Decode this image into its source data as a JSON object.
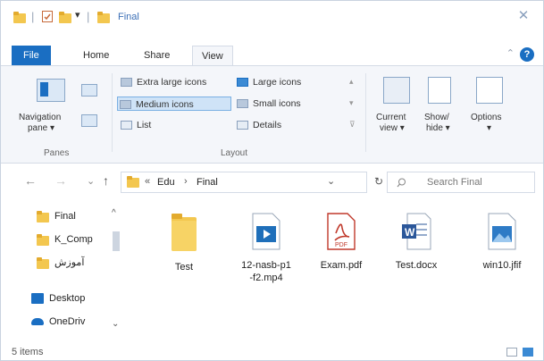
{
  "title": "Final",
  "quick_access": {
    "pin_symbol": "▾"
  },
  "window_controls": {
    "close": "✕"
  },
  "ribbon_tabs": {
    "file": "File",
    "home": "Home",
    "share": "Share",
    "view": "View"
  },
  "help_label": "?",
  "collapse_symbol": "⌃",
  "ribbon": {
    "navigation_pane_line1": "Navigation",
    "navigation_pane_line2": "pane ▾",
    "panes_label": "Panes",
    "layout": {
      "extra_large_icons": "Extra large icons",
      "large_icons": "Large icons",
      "medium_icons": "Medium icons",
      "small_icons": "Small icons",
      "list": "List",
      "details": "Details",
      "group_label": "Layout"
    },
    "current_view_line1": "Current",
    "current_view_line2": "view ▾",
    "show_hide_line1": "Show/",
    "show_hide_line2": "hide ▾",
    "options": "Options",
    "options_arrow": "▾"
  },
  "address": {
    "back": "←",
    "forward": "→",
    "recent": "⌄",
    "up": "↑",
    "chevrons": "«",
    "path": [
      "Edu",
      "Final"
    ],
    "separator": "›",
    "dropdown": "⌄",
    "refresh": "↻",
    "search_placeholder": "Search Final"
  },
  "nav_pane": {
    "items": [
      "Final",
      "K_Comp",
      "آموزش",
      "Desktop",
      "OneDriv"
    ],
    "scroll_up": "^",
    "scroll_down": "⌄"
  },
  "files": [
    {
      "name": "Test",
      "icon": "folder-icon"
    },
    {
      "name": "12-nasb-p1-f2.mp4",
      "name_line1": "12-nasb-p1",
      "name_line2": "-f2.mp4",
      "icon": "video-file-icon"
    },
    {
      "name": "Exam.pdf",
      "icon": "pdf-file-icon",
      "badge": "PDF"
    },
    {
      "name": "Test.docx",
      "icon": "word-file-icon",
      "badge": "W"
    },
    {
      "name": "win10.jfif",
      "icon": "image-file-icon"
    }
  ],
  "status": {
    "items": "5 items"
  }
}
